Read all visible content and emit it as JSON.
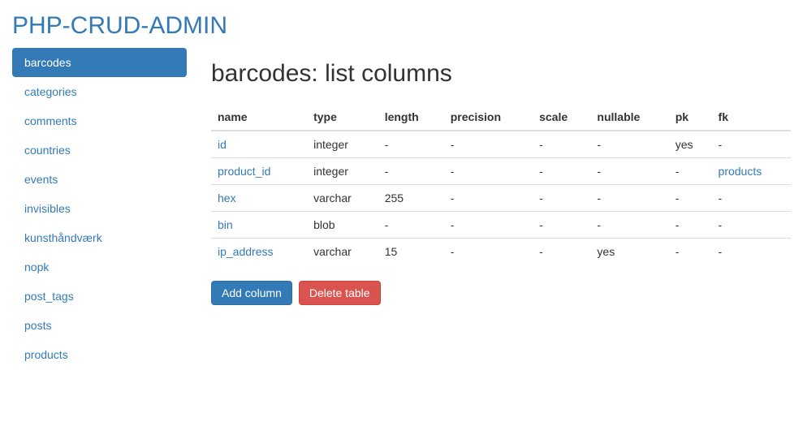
{
  "brand": "PHP-CRUD-ADMIN",
  "sidebar": {
    "items": [
      {
        "label": "barcodes",
        "active": true
      },
      {
        "label": "categories",
        "active": false
      },
      {
        "label": "comments",
        "active": false
      },
      {
        "label": "countries",
        "active": false
      },
      {
        "label": "events",
        "active": false
      },
      {
        "label": "invisibles",
        "active": false
      },
      {
        "label": "kunsthåndværk",
        "active": false
      },
      {
        "label": "nopk",
        "active": false
      },
      {
        "label": "post_tags",
        "active": false
      },
      {
        "label": "posts",
        "active": false
      },
      {
        "label": "products",
        "active": false
      }
    ]
  },
  "main": {
    "title": "barcodes: list columns",
    "table": {
      "headers": [
        "name",
        "type",
        "length",
        "precision",
        "scale",
        "nullable",
        "pk",
        "fk"
      ],
      "rows": [
        {
          "name": "id",
          "type": "integer",
          "length": "-",
          "precision": "-",
          "scale": "-",
          "nullable": "-",
          "pk": "yes",
          "fk": "-",
          "fkLink": false
        },
        {
          "name": "product_id",
          "type": "integer",
          "length": "-",
          "precision": "-",
          "scale": "-",
          "nullable": "-",
          "pk": "-",
          "fk": "products",
          "fkLink": true
        },
        {
          "name": "hex",
          "type": "varchar",
          "length": "255",
          "precision": "-",
          "scale": "-",
          "nullable": "-",
          "pk": "-",
          "fk": "-",
          "fkLink": false
        },
        {
          "name": "bin",
          "type": "blob",
          "length": "-",
          "precision": "-",
          "scale": "-",
          "nullable": "-",
          "pk": "-",
          "fk": "-",
          "fkLink": false
        },
        {
          "name": "ip_address",
          "type": "varchar",
          "length": "15",
          "precision": "-",
          "scale": "-",
          "nullable": "yes",
          "pk": "-",
          "fk": "-",
          "fkLink": false
        }
      ]
    },
    "buttons": {
      "add": "Add column",
      "delete": "Delete table"
    }
  }
}
